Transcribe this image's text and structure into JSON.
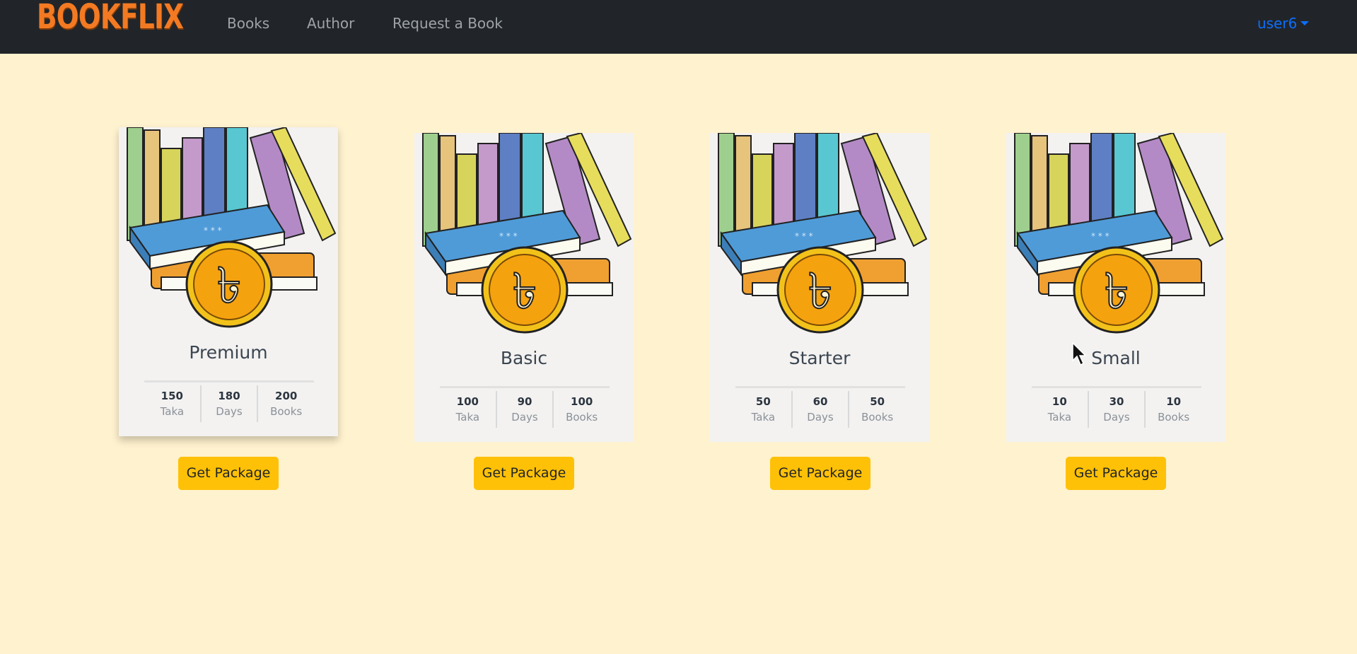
{
  "navbar": {
    "brand": "BOOKFLIX",
    "links": [
      "Books",
      "Author",
      "Request a Book"
    ],
    "user": "user6"
  },
  "packages": [
    {
      "name": "Premium",
      "taka": "150",
      "days": "180",
      "books": "200",
      "button": "Get Package"
    },
    {
      "name": "Basic",
      "taka": "100",
      "days": "90",
      "books": "100",
      "button": "Get Package"
    },
    {
      "name": "Starter",
      "taka": "50",
      "days": "60",
      "books": "50",
      "button": "Get Package"
    },
    {
      "name": "Small",
      "taka": "10",
      "days": "30",
      "books": "10",
      "button": "Get Package"
    }
  ],
  "units": {
    "taka": "Taka",
    "days": "Days",
    "books": "Books"
  },
  "colors": {
    "page_bg": "#fff2cf",
    "navbar_bg": "#212529",
    "brand": "#f37a22",
    "button": "#ffc107",
    "user_link": "#0d6efd"
  },
  "icons": {
    "card_art": "books-and-taka-coin-illustration",
    "user_caret": "caret-down-icon",
    "cursor": "mouse-pointer-icon"
  }
}
